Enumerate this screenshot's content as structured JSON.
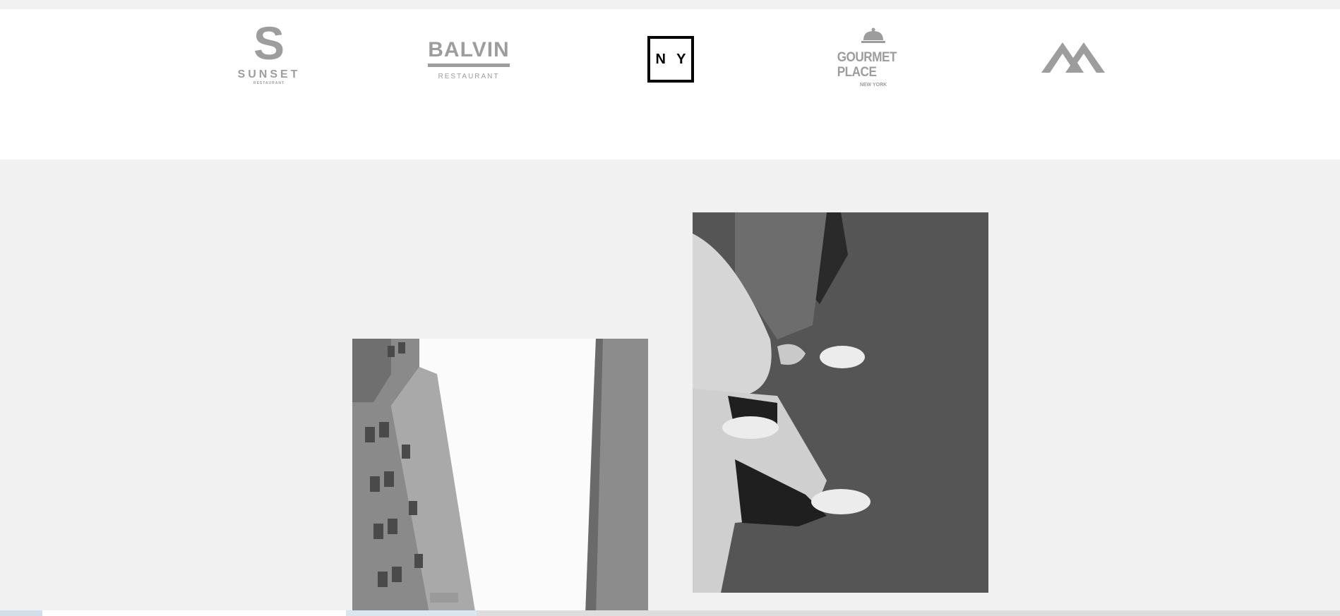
{
  "logos": [
    {
      "name": "Sunset Restaurant",
      "mark": "S",
      "word": "SUNSET",
      "sub": "RESTAURANT"
    },
    {
      "name": "Balvin Restaurant",
      "word": "BALVIN",
      "sub": "RESTAURANT"
    },
    {
      "name": "NY",
      "word": "N Y"
    },
    {
      "name": "Gourmet Place",
      "word": "GOURMET PLACE",
      "sub": "NEW YORK"
    },
    {
      "name": "Mountain logo",
      "icon": "mountain-icon"
    }
  ],
  "colors": {
    "page_background": "#f1f1f1",
    "band_background": "#ffffff",
    "logo_grey": "#9d9d9d"
  },
  "gallery": [
    {
      "subject": "street-buildings-photo"
    },
    {
      "subject": "sneakers-photo"
    }
  ]
}
